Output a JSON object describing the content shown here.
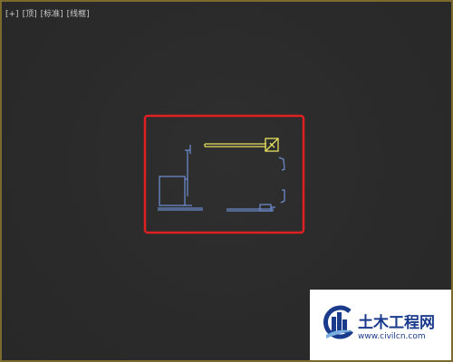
{
  "viewport": {
    "labels": {
      "plus": "[+]",
      "view": "[顶]",
      "shading": "[标准]",
      "mode": "[线框]"
    },
    "border_color": "#7a6a2e",
    "background_color": "#2a2a2a"
  },
  "scene": {
    "highlight_color": "#e02020",
    "wire_color": "#6a88c8",
    "selected_color": "#e8e060"
  },
  "watermark": {
    "title": "土木工程网",
    "url": "www.civilcn.com",
    "logo_icon": "building-c-logo-icon"
  }
}
